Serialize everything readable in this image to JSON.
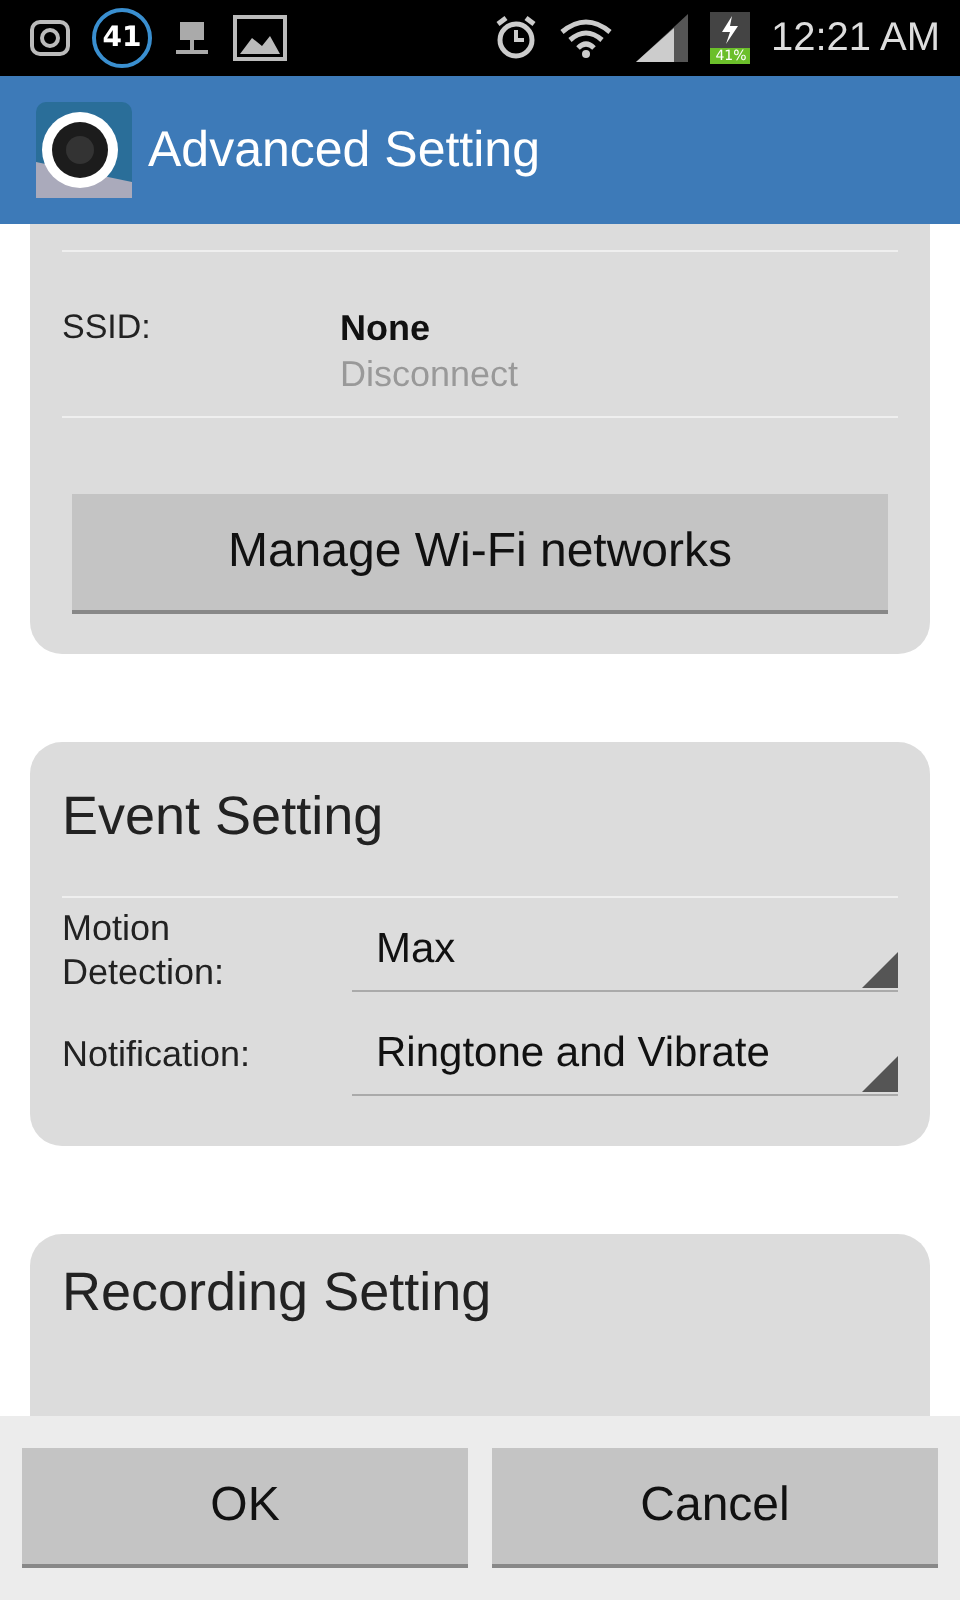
{
  "status_bar": {
    "notification_count": "41",
    "battery": "41%",
    "time": "12:21 AM"
  },
  "app_bar": {
    "title": "Advanced Setting"
  },
  "wifi_section": {
    "ssid_label": "SSID:",
    "ssid_value": "None",
    "ssid_status": "Disconnect",
    "button": "Manage Wi-Fi networks"
  },
  "event_section": {
    "title": "Event Setting",
    "rows": [
      {
        "label": "Motion Detection:",
        "value": "Max"
      },
      {
        "label": "Notification:",
        "value": "Ringtone and Vibrate"
      }
    ]
  },
  "recording_section": {
    "title": "Recording Setting"
  },
  "buttons": [
    "OK",
    "Cancel"
  ]
}
